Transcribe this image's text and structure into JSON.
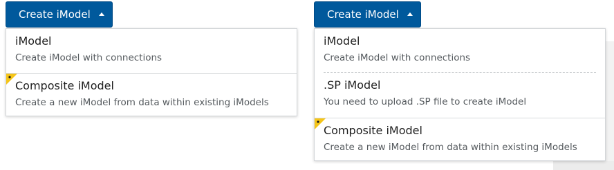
{
  "left_panel": {
    "button_label": "Create iModel",
    "items": [
      {
        "title": "iModel",
        "desc": "Create iModel with connections"
      },
      {
        "title": "Composite iModel",
        "desc": "Create a new iModel from data within existing iModels"
      }
    ]
  },
  "right_panel": {
    "button_label": "Create iModel",
    "items": [
      {
        "title": "iModel",
        "desc": "Create iModel with connections"
      },
      {
        "title": ".SP iModel",
        "desc": "You need to upload .SP file to create iModel"
      },
      {
        "title": "Composite iModel",
        "desc": "Create a new iModel from data within existing iModels"
      }
    ]
  },
  "colors": {
    "button_bg": "#00599c",
    "new_flag": "#f5c518"
  },
  "icons": {
    "caret": "caret-up-icon",
    "flag": "new-feature-flag-icon"
  }
}
